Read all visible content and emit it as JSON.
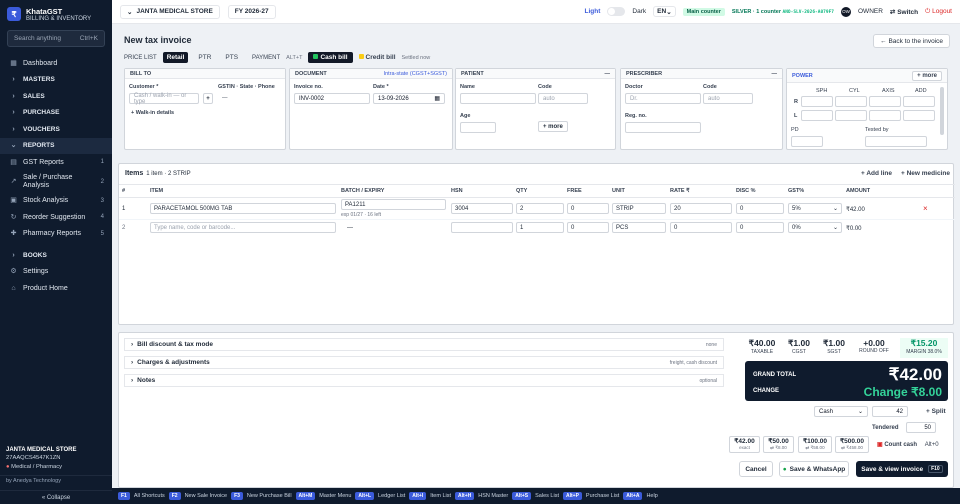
{
  "brand": {
    "name": "KhataGST",
    "subtitle": "BILLING & INVENTORY",
    "logo": "₹"
  },
  "sidebar": {
    "search_placeholder": "Search anything",
    "search_shortcut": "Ctrl+K",
    "items": [
      {
        "label": "Dashboard",
        "icon": "dashboard-icon"
      },
      {
        "label": "MASTERS"
      },
      {
        "label": "SALES"
      },
      {
        "label": "PURCHASE"
      },
      {
        "label": "VOUCHERS"
      },
      {
        "label": "REPORTS"
      },
      {
        "label": "GST Reports",
        "count": "1"
      },
      {
        "label": "Sale / Purchase Analysis",
        "count": "2"
      },
      {
        "label": "Stock Analysis",
        "count": "3"
      },
      {
        "label": "Reorder Suggestion",
        "count": "4"
      },
      {
        "label": "Pharmacy Reports",
        "count": "5"
      },
      {
        "label": "BOOKS"
      },
      {
        "label": "Settings"
      },
      {
        "label": "Product Home"
      }
    ],
    "shop_name": "JANTA MEDICAL STORE",
    "gstin": "27AAQCS4547K1ZN",
    "type": "Medical / Pharmacy",
    "by": "by Anedya Technology",
    "collapse": "« Collapse"
  },
  "topbar": {
    "store": "JANTA MEDICAL STORE",
    "fy": "FY 2026-27",
    "light": "Light",
    "dark": "Dark",
    "lang": "EN",
    "counter": "Main counter",
    "plan": "SILVER · 1 counter",
    "license": "ANO-SLV-2026-A079F7",
    "avatar": "OW",
    "role": "OWNER",
    "switch": "Switch",
    "logout": "Logout"
  },
  "invoice": {
    "title": "New tax invoice",
    "back": "Back to the invoice",
    "price_list_label": "PRICE LIST",
    "price_lists": [
      "Retail",
      "PTR",
      "PTS"
    ],
    "payment_label": "PAYMENT",
    "payment_hint": "ALT+T",
    "cash_bill": "Cash bill",
    "credit_bill": "Credit bill",
    "saved": "Settled now",
    "bill_to": {
      "header": "BILL TO",
      "customer_label": "Customer *",
      "customer_placeholder": "Cash / walk-in — or type",
      "gstin_label": "GSTIN · State · Phone",
      "gstin_value": "—",
      "walkin": "+ Walk-in details",
      "plus": "+"
    },
    "document": {
      "header": "DOCUMENT",
      "tax": "Intra-state (CGST+SGST)",
      "inv_label": "Invoice no.",
      "inv_value": "INV-0002",
      "date_label": "Date *",
      "date_value": "13-09-2026"
    },
    "patient": {
      "header": "PATIENT",
      "name_label": "Name",
      "code_label": "Code",
      "code_placeholder": "auto",
      "age_label": "Age",
      "more": "+ more"
    },
    "prescriber": {
      "header": "PRESCRIBER",
      "doctor_label": "Doctor",
      "doctor_placeholder": "Dr.",
      "code_label": "Code",
      "code_placeholder": "auto",
      "reg_label": "Reg. no."
    },
    "power": {
      "header": "POWER",
      "more": "+ more",
      "cols": [
        "SPH",
        "CYL",
        "AXIS",
        "ADD"
      ],
      "rows": [
        "R",
        "L"
      ],
      "pd": "PD",
      "tested": "Tested by"
    }
  },
  "items": {
    "title": "Items",
    "summary": "1 item · 2 STRIP",
    "add_line": "+ Add line",
    "new_medicine": "+ New medicine",
    "columns": [
      "#",
      "ITEM",
      "BATCH / EXPIRY",
      "HSN",
      "QTY",
      "FREE",
      "UNIT",
      "RATE ₹",
      "DISC %",
      "GST%",
      "AMOUNT"
    ],
    "rows": [
      {
        "n": "1",
        "item": "PARACETAMOL 500MG TAB",
        "batch": "PA1211",
        "expiry": "exp 01/27 · 16 left",
        "hsn": "3004",
        "qty": "2",
        "free": "0",
        "unit": "STRIP",
        "rate": "20",
        "disc": "0",
        "gst": "5%",
        "amount": "₹42.00"
      },
      {
        "n": "2",
        "item": "Type name, code or barcode...",
        "batch": "—",
        "hsn": "",
        "qty": "1",
        "free": "0",
        "unit": "PCS",
        "rate": "0",
        "disc": "0",
        "gst": "0%",
        "amount": "₹0.00"
      }
    ]
  },
  "sections": [
    {
      "label": "Bill discount & tax mode",
      "right": "none"
    },
    {
      "label": "Charges & adjustments",
      "right": "freight, cash discount"
    },
    {
      "label": "Notes",
      "right": "optional"
    }
  ],
  "totals": {
    "taxable": "₹40.00",
    "taxable_l": "TAXABLE",
    "cgst": "₹1.00",
    "cgst_l": "CGST",
    "sgst": "₹1.00",
    "sgst_l": "SGST",
    "roundoff": "+0.00",
    "roundoff_l": "ROUND OFF",
    "margin": "₹15.20",
    "margin_l": "MARGIN 38.0%",
    "grand_l": "GRAND TOTAL",
    "grand": "₹42.00",
    "change_l": "CHANGE",
    "change": "Change ₹8.00"
  },
  "payment": {
    "mode": "Cash",
    "amount": "42",
    "split": "+ Split",
    "tendered_l": "Tendered",
    "tendered": "50",
    "quick": [
      {
        "a": "₹42.00",
        "b": "exact"
      },
      {
        "a": "₹50.00",
        "b": "⇄ ₹8.00"
      },
      {
        "a": "₹100.00",
        "b": "⇄ ₹58.00"
      },
      {
        "a": "₹500.00",
        "b": "⇄ ₹458.00"
      }
    ],
    "count_cash": "Count cash",
    "count_key": "Alt+0"
  },
  "actions": {
    "cancel": "Cancel",
    "whatsapp": "Save & WhatsApp",
    "save": "Save & view invoice",
    "save_key": "F10"
  },
  "footer": [
    {
      "k": "F1",
      "t": "All Shortcuts"
    },
    {
      "k": "F2",
      "t": "New Sale Invoice"
    },
    {
      "k": "F3",
      "t": "New Purchase Bill"
    },
    {
      "k": "Alt+M",
      "t": "Master Menu"
    },
    {
      "k": "Alt+L",
      "t": "Ledger List"
    },
    {
      "k": "Alt+I",
      "t": "Item List"
    },
    {
      "k": "Alt+H",
      "t": "HSN Master"
    },
    {
      "k": "Alt+S",
      "t": "Sales List"
    },
    {
      "k": "Alt+P",
      "t": "Purchase List"
    },
    {
      "k": "Alt+A",
      "t": "Help"
    }
  ]
}
